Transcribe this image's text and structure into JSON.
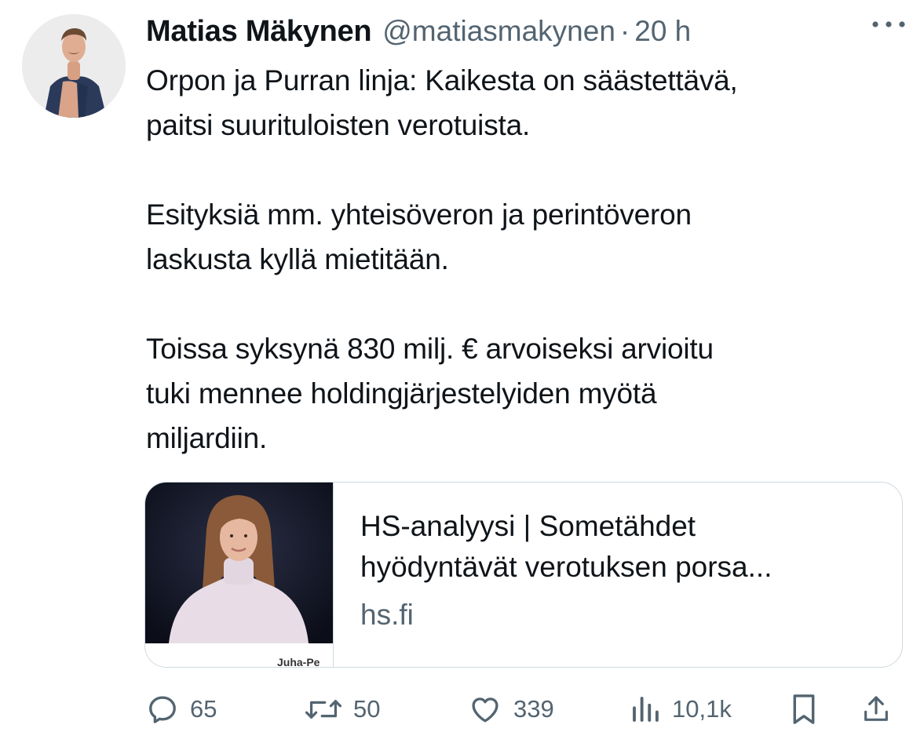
{
  "tweet": {
    "author_name": "Matias Mäkynen",
    "handle": "@matiasmakynen",
    "separator": "·",
    "time": "20 h",
    "paragraphs": [
      [
        "Orpon ja Purran linja: Kaikesta on säästettävä,",
        "paitsi suurituloisten verotuista."
      ],
      [
        "Esityksiä mm. yhteisöveron ja perintöveron",
        "laskusta kyllä mietitään."
      ],
      [
        "Toissa syksynä 830 milj. € arvoiseksi arvioitu",
        "tuki mennee holdingjärjestelyiden myötä",
        "miljardiin."
      ]
    ]
  },
  "card": {
    "title_line1": "HS-analyysi | Sometähdet",
    "title_line2": "hyödyntävät verotuksen porsa...",
    "domain": "hs.fi",
    "photo_caption": "Juha-Pe"
  },
  "actions": {
    "replies": "65",
    "reposts": "50",
    "likes": "339",
    "views": "10,1k"
  },
  "icons": {
    "more": "more-horizontal-icon",
    "reply": "reply-icon",
    "repost": "repost-icon",
    "like": "heart-icon",
    "views": "views-icon",
    "bookmark": "bookmark-icon",
    "share": "share-icon"
  },
  "colors": {
    "text": "#0f1419",
    "secondary": "#536471",
    "border": "#cfd9de"
  }
}
